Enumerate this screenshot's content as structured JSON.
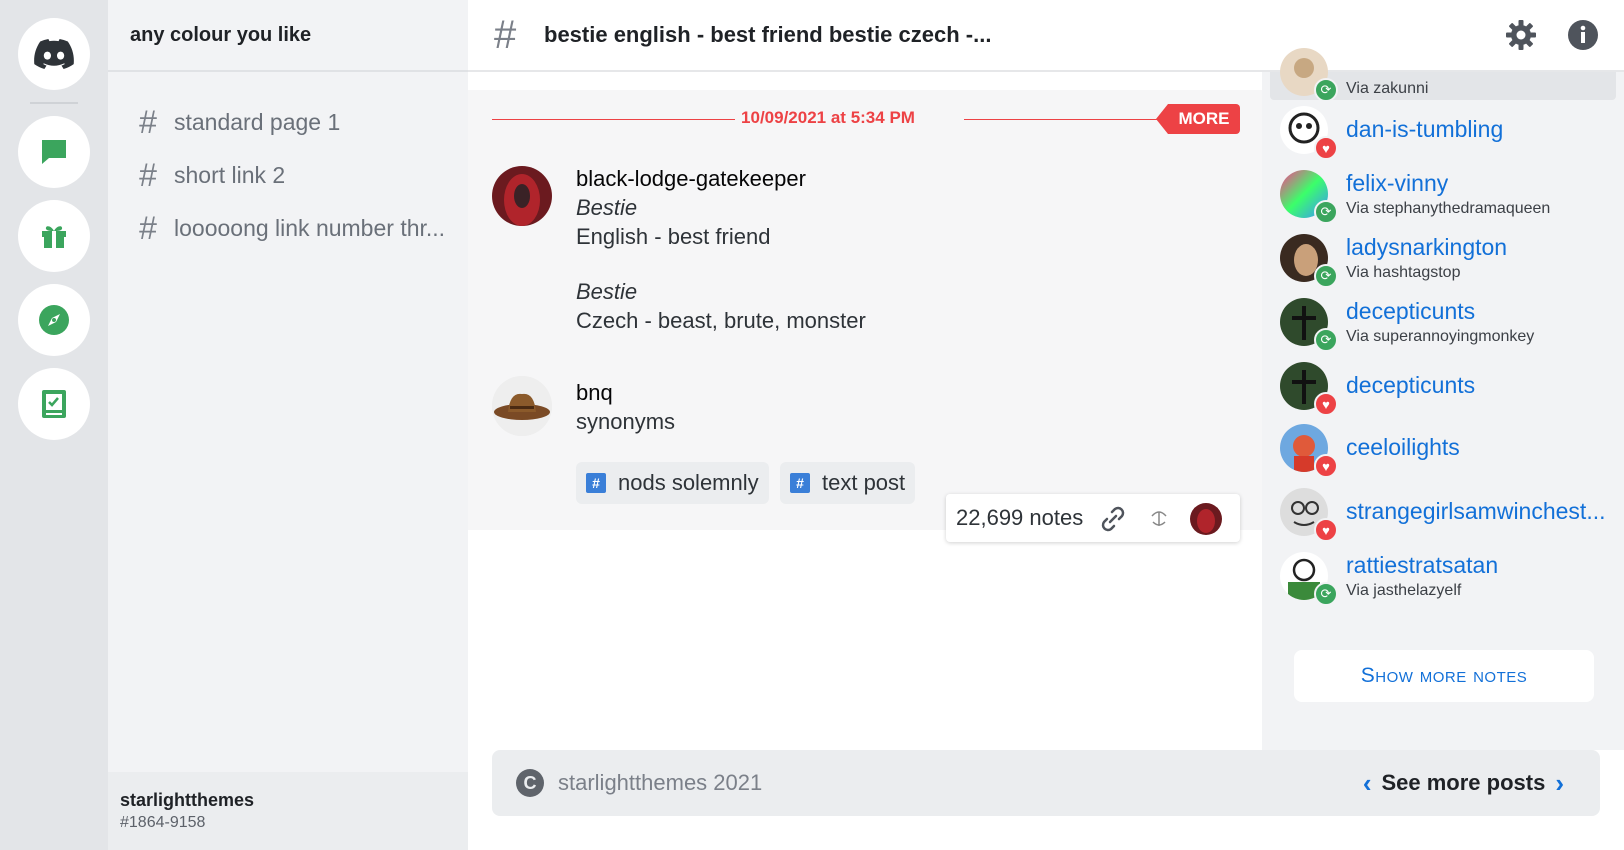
{
  "server": {
    "name": "any colour you like"
  },
  "rail": {
    "items": [
      {
        "icon": "discord-logo-icon"
      },
      {
        "icon": "chat-bubble-icon"
      },
      {
        "icon": "gift-icon"
      },
      {
        "icon": "compass-icon"
      },
      {
        "icon": "checklist-icon"
      }
    ]
  },
  "channels": [
    {
      "label": "standard page 1"
    },
    {
      "label": "short link 2"
    },
    {
      "label": "looooong link number thr..."
    }
  ],
  "user": {
    "name": "starlightthemes",
    "tag": "#1864-9158"
  },
  "header": {
    "title": "bestie english - best friend bestie czech -..."
  },
  "post": {
    "date": "10/09/2021 at 5:34 PM",
    "more_label": "MORE",
    "messages": [
      {
        "author": "black-lodge-gatekeeper",
        "lines": [
          "Bestie",
          "English - best friend",
          "Bestie",
          "Czech - beast, brute, monster"
        ]
      },
      {
        "author": "bnq",
        "lines": [
          "synonyms"
        ]
      }
    ],
    "tags": [
      "nods solemnly",
      "text post"
    ],
    "tag_icon": "#",
    "notes_count": "22,699 notes"
  },
  "notes": [
    {
      "name": "",
      "via": "Via zakunni",
      "type": "reblog"
    },
    {
      "name": "dan-is-tumbling",
      "via": "",
      "type": "like"
    },
    {
      "name": "felix-vinny",
      "via": "Via stephanythedramaqueen",
      "type": "reblog"
    },
    {
      "name": "ladysnarkington",
      "via": "Via hashtagstop",
      "type": "reblog"
    },
    {
      "name": "decepticunts",
      "via": "Via superannoyingmonkey",
      "type": "reblog"
    },
    {
      "name": "decepticunts",
      "via": "",
      "type": "like"
    },
    {
      "name": "ceeloilights",
      "via": "",
      "type": "like"
    },
    {
      "name": "strangegirlsamwinchest...",
      "via": "",
      "type": "like"
    },
    {
      "name": "rattiestratsatan",
      "via": "Via jasthelazyelf",
      "type": "reblog"
    }
  ],
  "show_more_label": "Show more notes",
  "footer": {
    "copyright_symbol": "C",
    "text": "starlightthemes 2021",
    "see_more": "See more posts"
  },
  "colors": {
    "accent_red": "#ed4245",
    "link_blue": "#1270d8",
    "green": "#3ba55d",
    "heart_red": "#ed4245"
  }
}
